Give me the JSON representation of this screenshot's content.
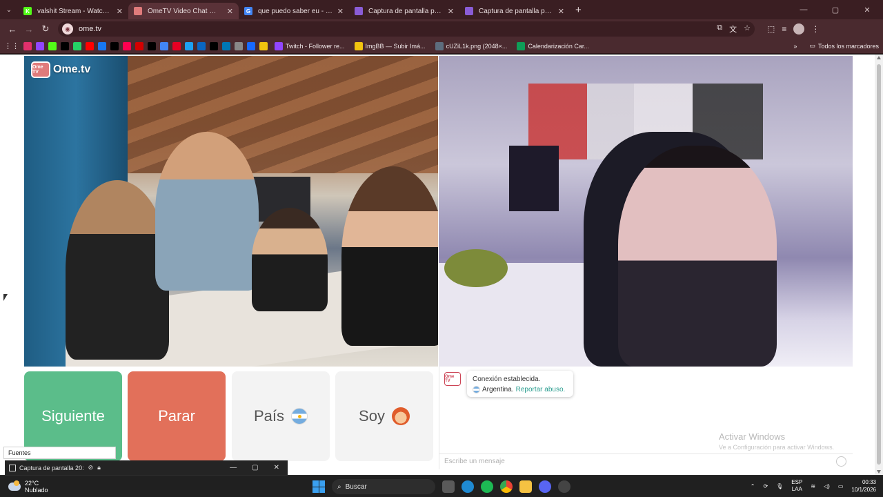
{
  "browser": {
    "tabs": [
      {
        "title": "valshit Stream - Watch Live on K",
        "fav_color": "#53fc18",
        "fav_letter": "K",
        "active": false
      },
      {
        "title": "OmeTV Video Chat — Ome",
        "fav_color": "#e07b7b",
        "fav_letter": "",
        "active": true
      },
      {
        "title": "que puedo saber eu - Buscar c",
        "fav_color": "#4285f4",
        "fav_letter": "G",
        "active": false
      },
      {
        "title": "Captura de pantalla por Lightsh",
        "fav_color": "#8a5cd6",
        "fav_letter": "",
        "active": false
      },
      {
        "title": "Captura de pantalla por Lightsh",
        "fav_color": "#8a5cd6",
        "fav_letter": "",
        "active": false
      }
    ],
    "url": "ome.tv",
    "bookmarks": [
      {
        "label": "Twitch - Follower re...",
        "color": "#9146ff"
      },
      {
        "label": "ImgBB — Subir Imá...",
        "color": "#f1c40f"
      },
      {
        "label": "cUZiL1k.png (2048×...",
        "color": "#5d6d7e"
      },
      {
        "label": "Calendarización Car...",
        "color": "#0f9d58"
      }
    ],
    "bookmark_icon_colors": [
      "#e1306c",
      "#9146ff",
      "#53fc18",
      "#000000",
      "#25d366",
      "#ff0000",
      "#1877f2",
      "#000000",
      "#ff0050",
      "#d40000",
      "#000000",
      "#4285f4",
      "#e60023",
      "#1da1f2",
      "#0a66c2",
      "#000000",
      "#0077b5",
      "#888888",
      "#1769ff",
      "#f1c40f"
    ],
    "all_bookmarks": "Todos los marcadores"
  },
  "site": {
    "logo_text": "Ome.tv",
    "logo_badge": "Ome TV",
    "buttons": {
      "next": "Siguiente",
      "stop": "Parar",
      "country": "País",
      "gender": "Soy"
    },
    "chat": {
      "connection": "Conexión establecida.",
      "country": "Argentina.",
      "report": "Reportar abuso.",
      "input_placeholder": "Escribe un mensaje",
      "watermark_title": "Activar Windows",
      "watermark_sub": "Ve a Configuración para activar Windows."
    }
  },
  "overlay": {
    "fuentes": "Fuentes",
    "thumb_title": "Captura de pantalla 20:"
  },
  "taskbar": {
    "temp": "22°C",
    "weather": "Nublado",
    "search": "Buscar",
    "lang_1": "ESP",
    "lang_2": "LAA",
    "time": "00:33",
    "date": "10/1/2026"
  },
  "colors": {
    "next": "#5bbd8a",
    "stop": "#e2705a",
    "neutral": "#f3f3f3"
  }
}
